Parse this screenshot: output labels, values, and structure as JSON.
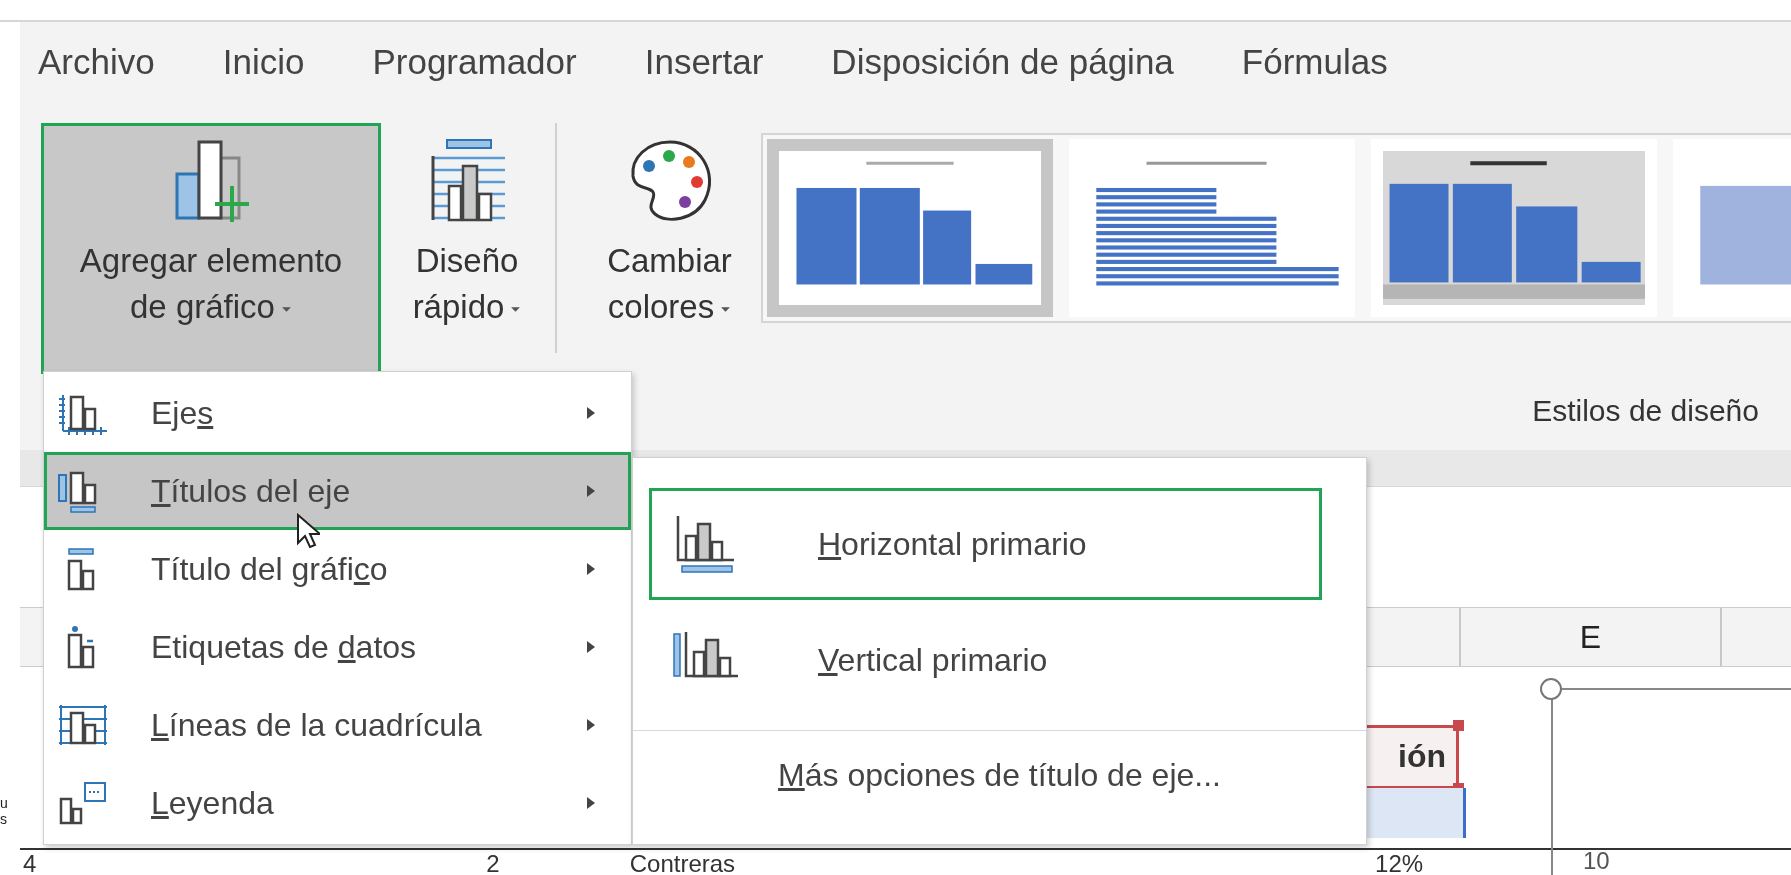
{
  "tabs": [
    {
      "label": "Archivo"
    },
    {
      "label": "Inicio"
    },
    {
      "label": "Programador"
    },
    {
      "label": "Insertar"
    },
    {
      "label": "Disposición de página"
    },
    {
      "label": "Fórmulas"
    }
  ],
  "ribbon": {
    "buttons": [
      {
        "label_lines": [
          "Agregar elemento",
          "de gráfico"
        ],
        "pressed": true
      },
      {
        "label_lines": [
          "Diseño",
          "rápido"
        ],
        "pressed": false
      },
      {
        "label_lines": [
          "Cambiar",
          "colores"
        ],
        "pressed": false
      }
    ],
    "styles_gallery": [
      {
        "kind": "plain",
        "selected": true
      },
      {
        "kind": "striped",
        "selected": false
      },
      {
        "kind": "shaded",
        "selected": false
      },
      {
        "kind": "soft",
        "selected": false
      }
    ],
    "group_label": "Estilos de diseño"
  },
  "menu": {
    "items": [
      {
        "before": "Eje",
        "key": "s",
        "selected": false
      },
      {
        "key": "T",
        "after": "ítulos del eje",
        "selected": true
      },
      {
        "before": "Título del gráfi",
        "key": "c",
        "after": "o",
        "selected": false
      },
      {
        "before": "Etiquetas de ",
        "key": "d",
        "after": "atos",
        "selected": false
      },
      {
        "key": "L",
        "after": "íneas de la cuadrícula",
        "selected": false
      },
      {
        "key": "L",
        "after": "eyenda",
        "selected": false
      }
    ]
  },
  "submenu": {
    "items": [
      {
        "key": "H",
        "after": "orizontal primario",
        "selected": true
      },
      {
        "key": "V",
        "after": "ertical primario",
        "selected": false
      }
    ],
    "more": {
      "key": "M",
      "after": "ás opciones de título de eje..."
    }
  },
  "sheet": {
    "column_header": "E",
    "header_cell": "ión",
    "row_header": "4",
    "cells": [
      "2",
      "Contreras",
      "12%"
    ],
    "chart_axis_label": "10",
    "side_fragments": [
      "u",
      "s"
    ]
  }
}
